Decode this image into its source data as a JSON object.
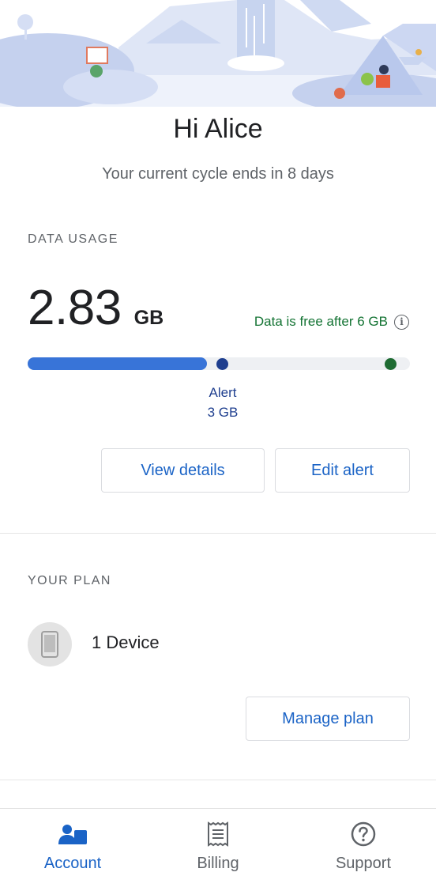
{
  "header": {
    "greeting": "Hi Alice",
    "cycle_text": "Your current cycle ends in 8 days"
  },
  "data_usage": {
    "section_label": "DATA USAGE",
    "value": "2.83",
    "unit": "GB",
    "free_note": "Data is free after 6 GB",
    "used_fraction": 0.47,
    "alert_fraction": 0.51,
    "free_fraction": 0.95,
    "alert_label": "Alert",
    "alert_amount": "3 GB",
    "view_details_label": "View details",
    "edit_alert_label": "Edit alert"
  },
  "plan": {
    "section_label": "YOUR PLAN",
    "device_text": "1 Device",
    "manage_plan_label": "Manage plan"
  },
  "bottom_nav": {
    "items": [
      {
        "label": "Account",
        "icon": "account-icon",
        "active": true
      },
      {
        "label": "Billing",
        "icon": "receipt-icon",
        "active": false
      },
      {
        "label": "Support",
        "icon": "help-circle-icon",
        "active": false
      }
    ]
  },
  "colors": {
    "accent": "#1a63c6",
    "bar_fill": "#3874d8",
    "alert_dot": "#1f3f8f",
    "free_dot": "#1e6b32",
    "free_text": "#137333"
  }
}
